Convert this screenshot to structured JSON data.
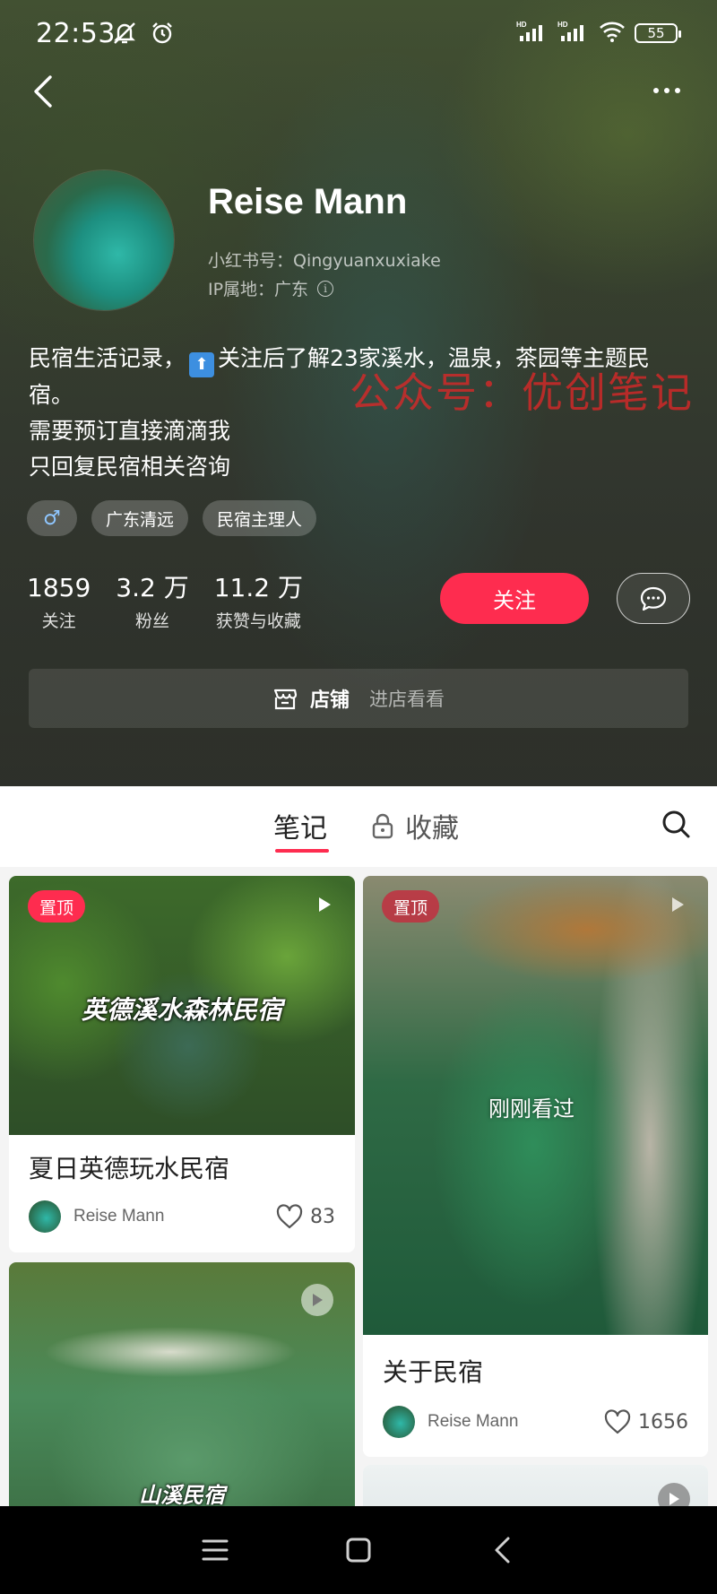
{
  "status_bar": {
    "time": "22:53",
    "battery": "55",
    "icons": [
      "mute-icon",
      "alarm-icon",
      "signal-hd-icon",
      "signal-hd-icon",
      "wifi-icon",
      "battery-icon"
    ]
  },
  "profile": {
    "name": "Reise Mann",
    "red_id": "小红书号：Qingyuanxuxiake",
    "ip_location": "IP属地：广东",
    "bio_line1_a": "民宿生活记录，",
    "bio_line1_b": "关注后了解23家溪水，温泉，茶园等主题民宿。",
    "bio_line2": "需要预订直接滴滴我",
    "bio_line3": "只回复民宿相关咨询",
    "watermark": "公众号：优创笔记",
    "tags": [
      "♂",
      "广东清远",
      "民宿主理人"
    ],
    "stats": [
      {
        "value": "1859",
        "label": "关注"
      },
      {
        "value": "3.2 万",
        "label": "粉丝"
      },
      {
        "value": "11.2 万",
        "label": "获赞与收藏"
      }
    ],
    "follow_label": "关注",
    "store_title": "店铺",
    "store_sub": "进店看看"
  },
  "tabs": {
    "notes": "笔记",
    "favorites": "收藏"
  },
  "feed": {
    "left": [
      {
        "badge": "置顶",
        "overlay": "英德溪水森林民宿",
        "title": "夏日英德玩水民宿",
        "author": "Reise Mann",
        "likes": "83"
      },
      {
        "overlay": "山溪民宿"
      }
    ],
    "right": [
      {
        "badge": "置顶",
        "overlay": "刚刚看过",
        "title": "关于民宿",
        "author": "Reise Mann",
        "likes": "1656"
      }
    ]
  },
  "colors": {
    "accent": "#fe2c4f",
    "header_bg": "#3f4b34"
  }
}
